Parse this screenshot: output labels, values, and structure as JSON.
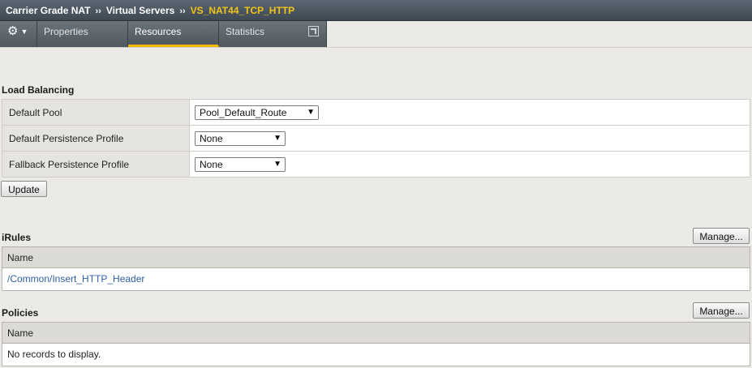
{
  "breadcrumb": {
    "items": [
      "Carrier Grade NAT",
      "Virtual Servers"
    ],
    "separator": "››",
    "current": "VS_NAT44_TCP_HTTP"
  },
  "tabs": {
    "properties": "Properties",
    "resources": "Resources",
    "statistics": "Statistics",
    "active": "Resources"
  },
  "load_balancing": {
    "title": "Load Balancing",
    "rows": [
      {
        "label": "Default Pool",
        "value": "Pool_Default_Route"
      },
      {
        "label": "Default Persistence Profile",
        "value": "None"
      },
      {
        "label": "Fallback Persistence Profile",
        "value": "None"
      }
    ],
    "update_label": "Update"
  },
  "irules": {
    "title": "iRules",
    "manage_label": "Manage...",
    "column": "Name",
    "rows": [
      "/Common/Insert_HTTP_Header"
    ]
  },
  "policies": {
    "title": "Policies",
    "manage_label": "Manage...",
    "column": "Name",
    "empty": "No records to display."
  },
  "icons": {
    "gear": "gear-icon",
    "caret": "caret-down-icon",
    "popout": "popout-window-icon",
    "dropdown": "dropdown-arrow-icon"
  },
  "colors": {
    "crumb_bg": "#4a545e",
    "current_crumb": "#f3c316",
    "active_tab_underline": "#f3b800",
    "link": "#2e5fa8",
    "page_bg": "#ebeae6"
  }
}
